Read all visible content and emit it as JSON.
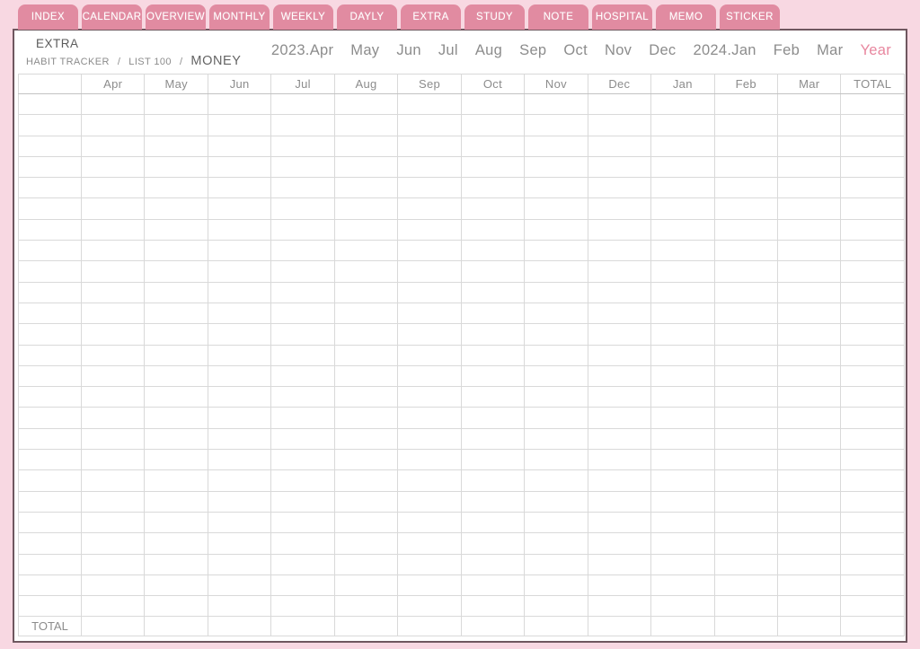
{
  "header": {
    "title": "EXTRA"
  },
  "tabs": [
    "INDEX",
    "CALENDAR",
    "OVERVIEW",
    "MONTHLY",
    "WEEKLY",
    "DAYLY",
    "EXTRA",
    "STUDY",
    "NOTE",
    "HOSPITAL",
    "MEMO",
    "STICKER"
  ],
  "subnav": {
    "items": [
      "HABIT TRACKER",
      "LIST 100",
      "MONEY"
    ],
    "separator": "/",
    "active": "MONEY"
  },
  "month_nav": {
    "items": [
      "2023.Apr",
      "May",
      "Jun",
      "Jul",
      "Aug",
      "Sep",
      "Oct",
      "Nov",
      "Dec",
      "2024.Jan",
      "Feb",
      "Mar",
      "Year"
    ],
    "active": "Year"
  },
  "table": {
    "columns": [
      "",
      "Apr",
      "May",
      "Jun",
      "Jul",
      "Aug",
      "Sep",
      "Oct",
      "Nov",
      "Dec",
      "Jan",
      "Feb",
      "Mar",
      "TOTAL"
    ],
    "body_rows": 25,
    "footer_label": "TOTAL"
  },
  "colors": {
    "outer_background": "#f8d8e2",
    "tab_pink": "#e18ba1",
    "tab_text": "#ffffff",
    "page_border": "#6f575f",
    "grid_line": "#d9d9d9",
    "grid_border": "#c2c2c2",
    "text_gray": "#8c8c8c",
    "text_dark": "#5c5c5c",
    "active_pink": "#e8879f"
  }
}
